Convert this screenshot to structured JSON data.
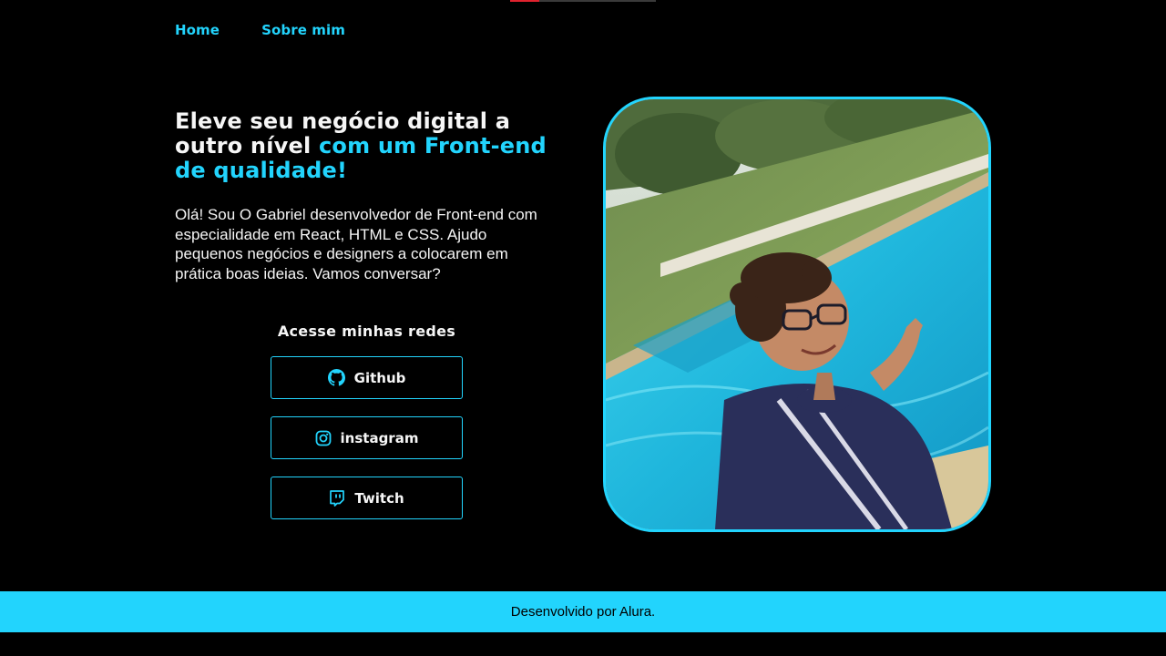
{
  "nav": {
    "items": [
      {
        "label": "Home"
      },
      {
        "label": "Sobre mim"
      }
    ]
  },
  "hero": {
    "headline_white": "Eleve seu negócio digital a outro nível ",
    "headline_accent": "com um Front-end de qualidade!",
    "intro": "Olá! Sou O Gabriel desenvolvedor de Front-end com especialidade em React, HTML e CSS. Ajudo pequenos negócios e designers a colocarem em prática boas ideias. Vamos conversar?"
  },
  "links": {
    "title": "Acesse minhas redes",
    "items": [
      {
        "label": "Github",
        "icon": "github-icon"
      },
      {
        "label": "instagram",
        "icon": "instagram-icon"
      },
      {
        "label": "Twitch",
        "icon": "twitch-icon"
      }
    ]
  },
  "photo": {
    "description": "profile-photo"
  },
  "footer": {
    "text": "Desenvolvido por Alura."
  },
  "colors": {
    "background": "#000000",
    "accent": "#22D4FD",
    "text": "#F6F6F6"
  }
}
